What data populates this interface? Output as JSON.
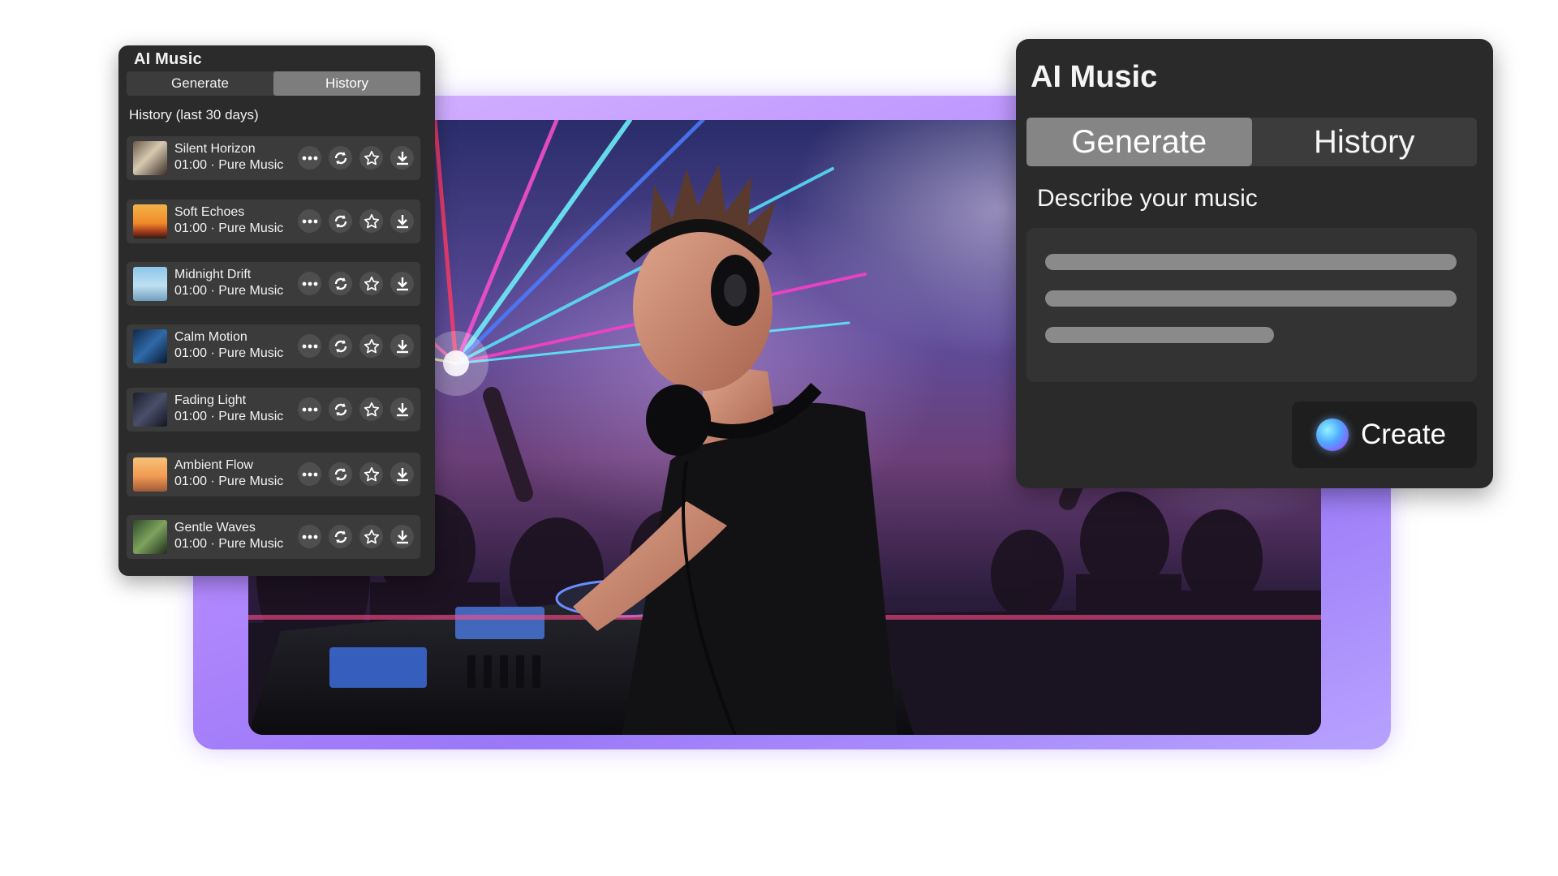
{
  "history_panel": {
    "title": "AI Music",
    "tabs": [
      "Generate",
      "History"
    ],
    "active_tab": "History",
    "subtitle": "History (last 30 days)",
    "items": [
      {
        "title": "Silent Horizon",
        "meta": "01:00 · Pure Music",
        "thumb": "statue"
      },
      {
        "title": "Soft Echoes",
        "meta": "01:00 · Pure Music",
        "thumb": "sunset-car"
      },
      {
        "title": "Midnight Drift",
        "meta": "01:00 · Pure Music",
        "thumb": "sky-birds"
      },
      {
        "title": "Calm Motion",
        "meta": "01:00 · Pure Music",
        "thumb": "city-night"
      },
      {
        "title": "Fading Light",
        "meta": "01:00 · Pure Music",
        "thumb": "dark-sky"
      },
      {
        "title": "Ambient Flow",
        "meta": "01:00 · Pure Music",
        "thumb": "beach-sunset"
      },
      {
        "title": "Gentle Waves",
        "meta": "01:00 · Pure Music",
        "thumb": "forest"
      }
    ],
    "row_actions": [
      "more-icon",
      "regenerate-icon",
      "star-icon",
      "download-icon"
    ]
  },
  "generate_panel": {
    "title": "AI Music",
    "tabs": [
      "Generate",
      "History"
    ],
    "active_tab": "Generate",
    "prompt_label": "Describe your music",
    "create_label": "Create"
  },
  "colors": {
    "panel_bg": "#2b2b2b",
    "row_bg": "#3b3b3b",
    "tab_active": "#7d7d7d",
    "frame_accent": "#b68cff"
  }
}
